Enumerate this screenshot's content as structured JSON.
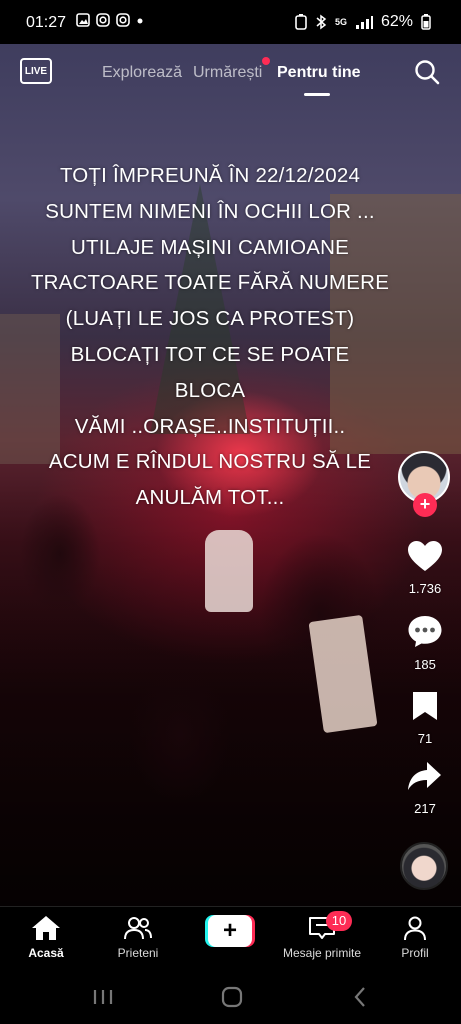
{
  "status_bar": {
    "time": "01:27",
    "battery": "62%",
    "network": "5G"
  },
  "top_nav": {
    "live_label": "LIVE",
    "tabs": [
      {
        "label": "Explorează"
      },
      {
        "label": "Urmărești"
      },
      {
        "label": "Pentru tine"
      }
    ]
  },
  "caption": {
    "lines": [
      "TOȚI ÎMPREUNĂ ÎN 22/12/2024",
      "SUNTEM NIMENI ÎN OCHII LOR ...",
      "UTILAJE MAȘINI CAMIOANE",
      "TRACTOARE TOATE FĂRĂ NUMERE",
      "(LUAȚI LE JOS CA PROTEST)",
      "BLOCAȚI TOT CE SE POATE",
      "BLOCA",
      "VĂMI ..ORAȘE..INSTITUȚII..",
      "ACUM E RÎNDUL NOSTRU SĂ LE",
      "ANULĂM  TOT..."
    ]
  },
  "side_actions": {
    "likes": "1.736",
    "comments": "185",
    "saves": "71",
    "shares": "217"
  },
  "bottom_nav": {
    "home": "Acasă",
    "friends": "Prieteni",
    "inbox": "Mesaje primite",
    "inbox_badge": "10",
    "profile": "Profil"
  },
  "colors": {
    "accent": "#fe2c55",
    "cyan": "#25f4ee"
  }
}
